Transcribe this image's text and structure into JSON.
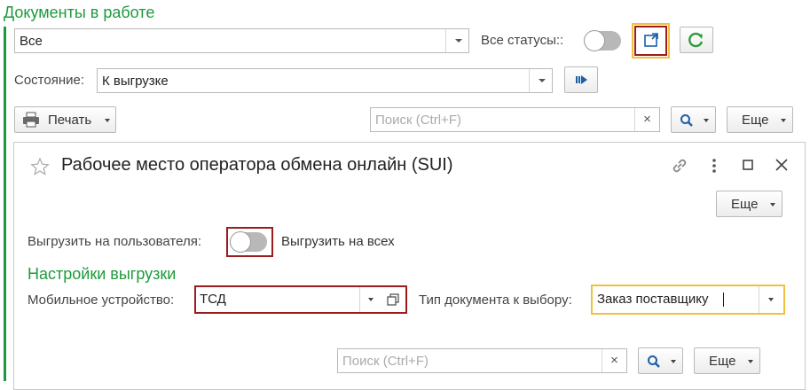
{
  "outer": {
    "title": "Документы в работе",
    "filter_value": "Все",
    "status_label": "Все статусы::",
    "state_label": "Состояние:",
    "state_value": "К выгрузке",
    "print_label": "Печать",
    "search_placeholder": "Поиск (Ctrl+F)",
    "search_clear": "×",
    "more_label": "Еще"
  },
  "dialog": {
    "title": "Рабочее место оператора обмена онлайн (SUI)",
    "more_label": "Еще",
    "upload_user_label": "Выгрузить на пользователя:",
    "upload_all_label": "Выгрузить на всех",
    "settings_title": "Настройки выгрузки",
    "mobile_device_label": "Мобильное устройство:",
    "mobile_device_value": "ТСД",
    "doc_type_label": "Тип документа к выбору:",
    "doc_type_value": "Заказ поставщику",
    "search_placeholder": "Поиск (Ctrl+F)",
    "search_clear": "×",
    "more2_label": "Еще"
  },
  "colors": {
    "accent_green": "#1e9a3c",
    "highlight_red": "#9b1c1c",
    "highlight_yellow": "#f0c040",
    "refresh_green": "#2e9a3c"
  },
  "icons": [
    "star-icon",
    "link-icon",
    "more-vert-icon",
    "maximize-icon",
    "close-icon",
    "printer-icon",
    "search-icon",
    "refresh-icon",
    "export-icon",
    "run-icon",
    "open-window-icon"
  ]
}
